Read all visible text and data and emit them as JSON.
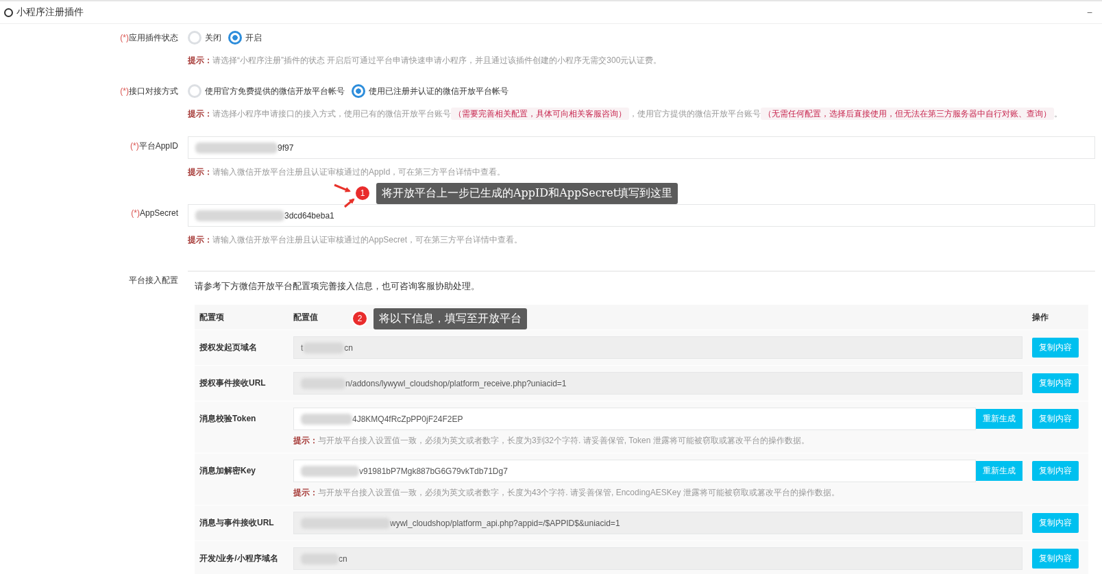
{
  "panel": {
    "title": "小程序注册插件",
    "collapse_symbol": "−"
  },
  "form": [
    {
      "kind": "radio",
      "label_mark": "(*)",
      "label": "应用插件状态",
      "options": [
        {
          "label": "关闭",
          "selected": false
        },
        {
          "label": "开启",
          "selected": true
        }
      ],
      "hint": {
        "label": "提示：",
        "parts": [
          {
            "text": "请选择“小程序注册”插件的状态 开启后可通过平台申请快速申请小程序，并且通过该插件创建的小程序无需交300元认证费。",
            "highlight": false
          }
        ]
      }
    },
    {
      "kind": "radio",
      "label_mark": "(*)",
      "label": "接口对接方式",
      "options": [
        {
          "label": "使用官方免费提供的微信开放平台帐号",
          "selected": false
        },
        {
          "label": "使用已注册并认证的微信开放平台帐号",
          "selected": true
        }
      ],
      "hint": {
        "label": "提示：",
        "parts": [
          {
            "text": "请选择小程序申请接口的接入方式，使用已有的微信开放平台账号",
            "highlight": false
          },
          {
            "text": "（需要完善相关配置，具体可向相关客服咨询）",
            "highlight": true
          },
          {
            "text": "，使用官方提供的微信开放平台账号",
            "highlight": false
          },
          {
            "text": "（无需任何配置，选择后直接使用，但无法在第三方服务器中自行对账、查询）",
            "highlight": true
          },
          {
            "text": "。",
            "highlight": false
          }
        ]
      }
    },
    {
      "kind": "input",
      "label_mark": "(*)",
      "label": "平台AppID",
      "value": "9f97",
      "hint": {
        "label": "提示：",
        "parts": [
          {
            "text": "请输入微信开放平台注册且认证审核通过的AppId，可在第三方平台详情中查看。",
            "highlight": false
          }
        ]
      }
    },
    {
      "kind": "input",
      "label_mark": "(*)",
      "label": "AppSecret",
      "value": "3dcd64beba1",
      "hint": {
        "label": "提示：",
        "parts": [
          {
            "text": "请输入微信开放平台注册且认证审核通过的AppSecret，可在第三方平台详情中查看。",
            "highlight": false
          }
        ]
      }
    }
  ],
  "config": {
    "label": "平台接入配置",
    "intro": "请参考下方微信开放平台配置项完善接入信息，也可咨询客服协助处理。",
    "columns": [
      "配置项",
      "配置值",
      "操作"
    ],
    "rows": [
      {
        "name": "授权发起页域名",
        "kind": "readonly",
        "prefix": "t",
        "value": "cn",
        "buttons": [
          "复制内容"
        ]
      },
      {
        "name": "授权事件接收URL",
        "kind": "readonly",
        "value": "n/addons/lywywl_cloudshop/platform_receive.php?uniacid=1",
        "buttons": [
          "复制内容"
        ]
      },
      {
        "name": "消息校验Token",
        "kind": "editable",
        "value": "4J8KMQ4fRcZpPP0jF24F2EP",
        "regen": "重新生成",
        "buttons": [
          "复制内容"
        ],
        "hint": {
          "label": "提示：",
          "parts": [
            {
              "text": "与开放平台接入设置值一致，必须为英文或者数字，长度为3到32个字符. 请妥善保管, Token 泄露将可能被窃取或篡改平台的操作数据。",
              "highlight": false
            }
          ]
        }
      },
      {
        "name": "消息加解密Key",
        "kind": "editable",
        "value": "v91981bP7Mgk887bG6G79vkTdb71Dg7",
        "regen": "重新生成",
        "buttons": [
          "复制内容"
        ],
        "hint": {
          "label": "提示：",
          "parts": [
            {
              "text": "与开放平台接入设置值一致，必须为英文或者数字，长度为43个字符. 请妥善保管, EncodingAESKey 泄露将可能被窃取或篡改平台的操作数据。",
              "highlight": false
            }
          ]
        }
      },
      {
        "name": "消息与事件接收URL",
        "kind": "readonly",
        "value": "wywl_cloudshop/platform_api.php?appid=/$APPID$&uniacid=1",
        "buttons": [
          "复制内容"
        ]
      },
      {
        "name": "开发/业务/小程序域名",
        "kind": "readonly",
        "value": "cn",
        "buttons": [
          "复制内容"
        ]
      }
    ]
  },
  "annotations": [
    {
      "number": "1",
      "text": "将开放平台上一步已生成的AppID和AppSecret填写到这里"
    },
    {
      "number": "2",
      "text": "将以下信息，填写至开放平台"
    }
  ]
}
